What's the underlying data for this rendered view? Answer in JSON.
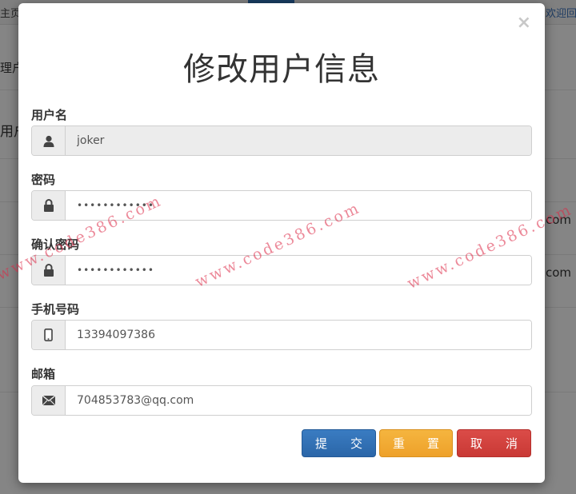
{
  "background": {
    "top_left": "主页",
    "top_right": "欢迎回来",
    "side_label_1": "理户",
    "side_label_2": "用户",
    "row_text_1": "com",
    "row_text_2": "com"
  },
  "modal": {
    "close_glyph": "×",
    "title": "修改用户信息",
    "fields": {
      "username": {
        "label": "用户名",
        "value": "joker",
        "icon": "user-icon"
      },
      "password": {
        "label": "密码",
        "value": "••••••••••••",
        "icon": "lock-icon"
      },
      "confirm_password": {
        "label": "确认密码",
        "value": "••••••••••••",
        "icon": "lock-icon"
      },
      "phone": {
        "label": "手机号码",
        "value": "13394097386",
        "icon": "mobile-phone-icon"
      },
      "email": {
        "label": "邮箱",
        "value": "704853783@qq.com",
        "icon": "envelope-icon"
      }
    },
    "buttons": {
      "submit": [
        "提",
        "交"
      ],
      "reset": [
        "重",
        "置"
      ],
      "cancel": [
        "取",
        "消"
      ]
    }
  },
  "watermark": {
    "text_1": "www.code386.com",
    "text_2": "www.code386.com",
    "text_3": "www.code386.com"
  },
  "colors": {
    "submit": "#3274b9",
    "reset": "#f0a830",
    "cancel": "#d2403c"
  }
}
